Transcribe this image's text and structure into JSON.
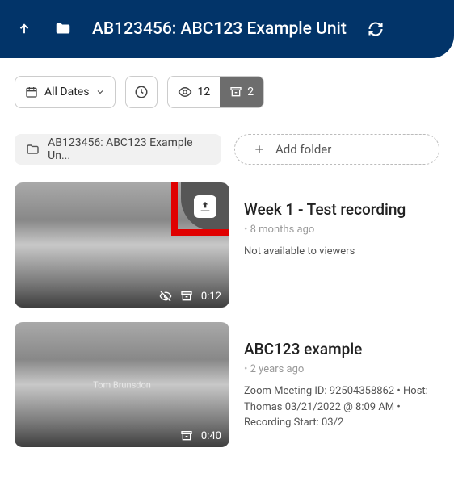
{
  "header": {
    "title": "AB123456: ABC123 Example Unit"
  },
  "toolbar": {
    "all_dates": "All Dates",
    "views": "12",
    "items": "2"
  },
  "breadcrumb": "AB123456: ABC123 Example Un...",
  "add_folder": "Add folder",
  "recordings": [
    {
      "title": "Week 1 - Test recording",
      "age": "8 months ago",
      "status": "Not available to viewers",
      "duration": "0:12",
      "hidden": true,
      "has_publish_badge": true
    },
    {
      "title": "ABC123 example",
      "age": "2 years ago",
      "status": "Zoom Meeting ID: 92504358862   • Host: Thomas 03/21/2022 @ 8:09 AM   • Recording Start: 03/2",
      "duration": "0:40",
      "watermark": "Tom Brunsdon"
    }
  ]
}
